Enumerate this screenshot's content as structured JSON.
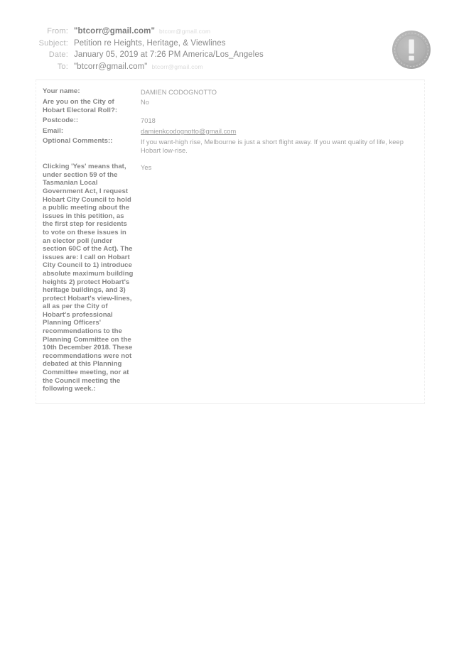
{
  "email_header": {
    "rows": [
      {
        "label": "From:",
        "value": "\"btcorr@gmail.com\"",
        "faint": "btcorr@gmail.com",
        "strong": true
      },
      {
        "label": "Subject:",
        "value": "Petition re Heights, Heritage, & Viewlines",
        "faint": "",
        "strong": false
      },
      {
        "label": "Date:",
        "value": "January 05, 2019 at 7:26 PM America/Los_Angeles",
        "faint": "",
        "strong": false
      },
      {
        "label": "To:",
        "value": "\"btcorr@gmail.com\"",
        "faint": "btcorr@gmail.com",
        "strong": false
      }
    ]
  },
  "seal": {
    "icon": "exclamation-seal-icon",
    "glyph": "!",
    "color": "#9a9a9a"
  },
  "form": {
    "fields": [
      {
        "label": "Your name:",
        "value": "DAMIEN CODOGNOTTO",
        "is_link": false
      },
      {
        "label": "Are you on the City of Hobart Electoral Roll?:",
        "value": "No",
        "is_link": false
      },
      {
        "label": "Postcode::",
        "value": "7018",
        "is_link": false
      },
      {
        "label": "Email:",
        "value": "damienkcodognotto@gmail.com",
        "is_link": true
      },
      {
        "label": "Optional Comments::",
        "value": "If you want-high rise, Melbourne is just a short flight away. If you want quality of life, keep Hobart low-rise.",
        "is_link": false
      }
    ],
    "statement": {
      "label": "Clicking 'Yes' means that, under section 59 of the Tasmanian Local Government Act, I request Hobart City Council to hold a public meeting about the issues in this petition, as the first step for residents to vote on these issues in an elector poll (under section 60C of the Act). The issues are: I call on Hobart City Council to 1) introduce absolute maximum building heights 2) protect Hobart's heritage buildings, and 3) protect Hobart's view-lines, all as per the City of Hobart's professional Planning Officers' recommendations to the Planning Committee on the 10th December 2018. These recommendations were not debated at this Planning Committee meeting, nor at the Council meeting the following week.:",
      "value": "Yes"
    }
  }
}
